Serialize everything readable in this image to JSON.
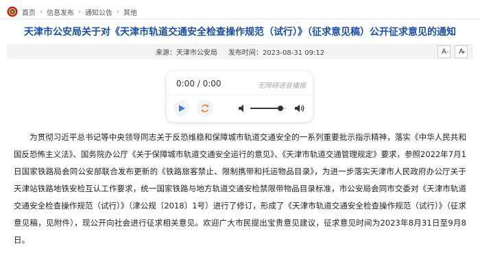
{
  "breadcrumb": {
    "items": [
      "首页",
      "信息发布",
      "通知公告",
      "其他"
    ],
    "separator": "›"
  },
  "article": {
    "title": "天津市公安局关于对《天津市轨道交通安全检查操作规范（试行）》（征求意见稿）公开征求意见的通知",
    "meta": {
      "source_label": "来源：",
      "source": "天津市公安局",
      "date_label": "发布时间：",
      "date": "2023-08-31 09:12"
    },
    "font_controls": {
      "decrease": "A",
      "decrease_sup": "-",
      "increase": "A",
      "increase_sup": "+"
    },
    "body": "为贯彻习近平总书记等中央领导同志关于反恐维稳和保障城市轨道交通安全的一系列重要批示指示精神，落实《中华人民共和国反恐怖主义法》、国务院办公厅《关于保障城市轨道交通安全运行的意见》、《天津市轨道交通管理规定》要求，参照2022年7月1日国家铁路局会同公安部联合发布更新的《铁路旅客禁止、限制携带和托运物品目录》，为进一步落实天津市人民政府办公厅关于天津站铁路地铁安检互认工作要求，统一国家铁路与地方轨道交通安检禁限带物品目录标准，市公安局会同市交委对《天津市轨道交通安全检查操作规范（试行）》（津公规〔2018〕1号）进行了修订，形成了《天津市轨道交通安全检查操作规范（试行）》（征求意见稿，见附件），现公开向社会进行征求相关意见。欢迎广大市民提出宝贵意见建议，征求意见时间为2023年8月31日至9月8日。"
  },
  "player": {
    "time": "0:00 / 0:00",
    "accessibility_label": "无障碍语音播报",
    "volume": 0.85,
    "icons": {
      "play": "play-icon",
      "loop": "loop-icon",
      "volume_low": "volume-low-icon",
      "volume_high": "volume-high-icon"
    }
  },
  "colors": {
    "title": "#1a4fa0",
    "play_blue": "#3d7ddb",
    "loop_orange": "#e8823a",
    "meta_bg": "#f3f3f3",
    "emblem_red": "#c8161d"
  }
}
